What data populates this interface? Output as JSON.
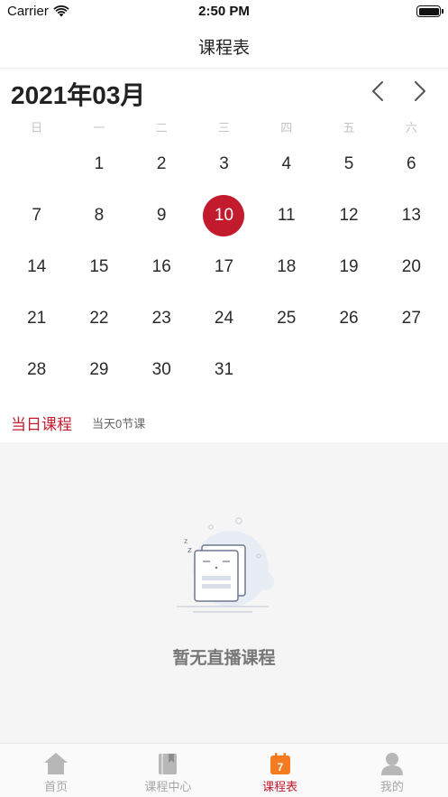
{
  "status_bar": {
    "carrier": "Carrier",
    "time": "2:50 PM"
  },
  "nav": {
    "title": "课程表"
  },
  "calendar": {
    "month_label": "2021年03月",
    "weekdays": [
      "日",
      "一",
      "二",
      "三",
      "四",
      "五",
      "六"
    ],
    "weeks": [
      [
        "",
        "1",
        "2",
        "3",
        "4",
        "5",
        "6"
      ],
      [
        "7",
        "8",
        "9",
        "10",
        "11",
        "12",
        "13"
      ],
      [
        "14",
        "15",
        "16",
        "17",
        "18",
        "19",
        "20"
      ],
      [
        "21",
        "22",
        "23",
        "24",
        "25",
        "26",
        "27"
      ],
      [
        "28",
        "29",
        "30",
        "31",
        "",
        "",
        ""
      ]
    ],
    "selected_day": "10",
    "accent_color": "#c31b2e"
  },
  "daily": {
    "title": "当日课程",
    "count_text": "当天0节课"
  },
  "empty_state": {
    "message": "暂无直播课程",
    "icon": "sleeping-document-illustration"
  },
  "tab_bar": {
    "items": [
      {
        "label": "首页",
        "icon": "home-icon",
        "active": false
      },
      {
        "label": "课程中心",
        "icon": "book-icon",
        "active": false
      },
      {
        "label": "课程表",
        "icon": "calendar-icon",
        "active": true,
        "badge": "7"
      },
      {
        "label": "我的",
        "icon": "profile-icon",
        "active": false
      }
    ]
  }
}
